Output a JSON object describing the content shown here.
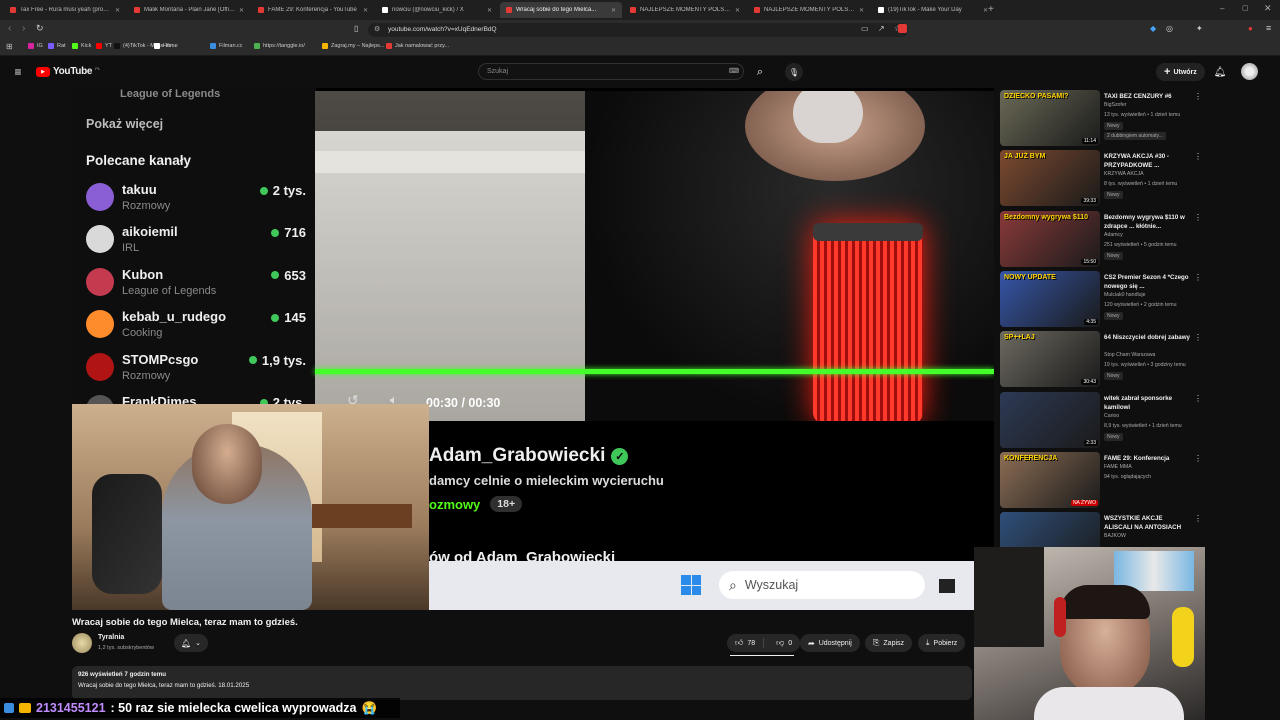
{
  "tabs": [
    {
      "label": "Tax Free - Rura musi yeah (prod. CL...",
      "color": "#e53935"
    },
    {
      "label": "Malik Montana - Plain Jane [Official ...",
      "color": "#e53935"
    },
    {
      "label": "FAME 29: Konferencja - YouTube",
      "color": "#e53935"
    },
    {
      "label": "nowciu (@nowciu_kick) / X",
      "color": "#ffffff"
    },
    {
      "label": "Wracaj sobie do tego Mielca...",
      "color": "#e53935"
    },
    {
      "label": "NAJLEPSZE MOMENTY POLSKIEGO ...",
      "color": "#e53935"
    },
    {
      "label": "NAJLEPSZE MOMENTY POLSKIEGO ...",
      "color": "#e53935"
    },
    {
      "label": "(19)TikTok - Make Your Day",
      "color": "#ffffff"
    }
  ],
  "address": {
    "url": "youtube.com/watch?v=xUqEdnerBdQ"
  },
  "bookmarks": [
    {
      "label": "IG",
      "color": "#d6249f"
    },
    {
      "label": "Rat",
      "color": "#7b5cff"
    },
    {
      "label": "Kick",
      "color": "#53fc18"
    },
    {
      "label": "YT",
      "color": "#ff0000"
    },
    {
      "label": "(4)TikTok - Make Yo...",
      "color": "#111111"
    },
    {
      "label": "Home",
      "color": "#ffffff"
    },
    {
      "label": "Filman.cc",
      "color": "#3a8dde"
    },
    {
      "label": "https://tanggle.io/",
      "color": "#4caf50"
    },
    {
      "label": "Zagraj.my – Najleps...",
      "color": "#f5b400"
    },
    {
      "label": "Jak namalować przy...",
      "color": "#e53935"
    }
  ],
  "header": {
    "logo": "YouTube",
    "region": "PL",
    "search_placeholder": "Szukaj",
    "create_label": "Utwórz"
  },
  "stream": {
    "show_more": "Pokaż więcej",
    "league": "League of Legends",
    "recommended_title": "Polecane kanały",
    "channels": [
      {
        "name": "takuu",
        "game": "Rozmowy",
        "viewers": "2 tys.",
        "color": "#8a5fd6"
      },
      {
        "name": "aikoiemil",
        "game": "IRL",
        "viewers": "716",
        "color": "#d9d9d9"
      },
      {
        "name": "Kubon",
        "game": "League of Legends",
        "viewers": "653",
        "color": "#c43b4f"
      },
      {
        "name": "kebab_u_rudego",
        "game": "Cooking",
        "viewers": "145",
        "color": "#ff8c2a"
      },
      {
        "name": "STOMPcsgo",
        "game": "Rozmowy",
        "viewers": "1,9 tys.",
        "color": "#b01414"
      },
      {
        "name": "FrankDimes",
        "game": "",
        "viewers": "2 tys.",
        "color": "#555555"
      }
    ],
    "time": "00:30 / 00:30",
    "progress": 1.0,
    "streamer_name": "Adam_Grabowiecki",
    "stream_title": "damcy celnie o mieleckim wycieruchu",
    "stream_category": "ozmowy",
    "age_badge": "18+",
    "more_from": "ów od Adam_Grabowiecki",
    "taskbar_search": "Wyszukaj"
  },
  "video": {
    "title": "Wracaj sobie do tego Mielca, teraz mam to gdzieś.",
    "channel": "Tyralnia",
    "subscribers": "1,2 tys. subskrybentów",
    "likes": "78",
    "dislikes": "0",
    "share": "Udostępnij",
    "save": "Zapisz",
    "download": "Pobierz",
    "views_line": "926 wyświetleń  7 godzin temu",
    "desc_line": "Wracaj sobie do tego Mielca, teraz mam to gdzieś. 18.01.2025"
  },
  "recommendations": [
    {
      "title": "TAXI BEZ CENZURY #6",
      "channel": "BigSzofer",
      "meta": "13 tys. wyświetleń • 1 dzień temu",
      "badge": "Nowy",
      "badge2": "2 dubbingiem automaty...",
      "duration": "11:14",
      "color": "#6b6a57",
      "overlay": "DZIECKO PASAMI?"
    },
    {
      "title": "KRZYWA AKCJA #30 - PRZYPADKOWE ...",
      "channel": "KRZYWA AKCJA",
      "meta": "8 tys. wyświetleń • 1 dzień temu",
      "badge": "Nowy",
      "badge2": "",
      "duration": "39:33",
      "color": "#7d4a2f",
      "overlay": "JA JUŻ BYM"
    },
    {
      "title": "Bezdomny wygrywa $110 w zdrapce ... kłótnie...",
      "channel": "Adamcy",
      "meta": "251 wyświetleń • 5 godzin temu",
      "badge": "Nowy",
      "badge2": "",
      "duration": "15:50",
      "color": "#8a3a3a",
      "overlay": "Bezdomny wygrywa $110"
    },
    {
      "title": "CS2 Premier Sezon 4 *Czego nowego się ...",
      "channel": "Mulciak0 handluje",
      "meta": "120 wyświetleń • 2 godzin temu",
      "badge": "Nowy",
      "badge2": "",
      "duration": "4:35",
      "color": "#3656a8",
      "overlay": "NOWY UPDATE"
    },
    {
      "title": "64 Niszczyciel dobrej zabawy",
      "channel": "Stop Cham Warszawa",
      "meta": "19 tys. wyświetleń • 3 godziny temu",
      "badge": "Nowy",
      "badge2": "",
      "duration": "30:43",
      "color": "#6d6a60",
      "overlay": "SP++LAJ"
    },
    {
      "title": "witek zabrał sponsorke kamilowi",
      "channel": "Carioo",
      "meta": "8,9 tys. wyświetleń • 1 dzień temu",
      "badge": "Nowy",
      "badge2": "",
      "duration": "2:33",
      "color": "#2d3a55",
      "overlay": ""
    },
    {
      "title": "FAME 29: Konferencja",
      "channel": "FAME MMA",
      "meta": "94 tys. oglądających",
      "badge": "",
      "badge2": "",
      "duration": "NA ŻYWO",
      "color": "#8c6e55",
      "overlay": "KONFERENCJA"
    },
    {
      "title": "WSZYSTKIE AKCJE ALISCALI NA ANTOSIACH",
      "channel": "BAJKOW",
      "meta": "",
      "badge": "",
      "badge2": "",
      "duration": "",
      "color": "#2f4f7a",
      "overlay": ""
    }
  ],
  "chat": {
    "username": "2131455121",
    "message": ": 50 raz sie mielecka cwelica wyprowadza",
    "emoji": "😭"
  },
  "colors": {
    "accent": "#ff0000",
    "live_green": "#3fc859",
    "progress": "#43ff2a"
  }
}
